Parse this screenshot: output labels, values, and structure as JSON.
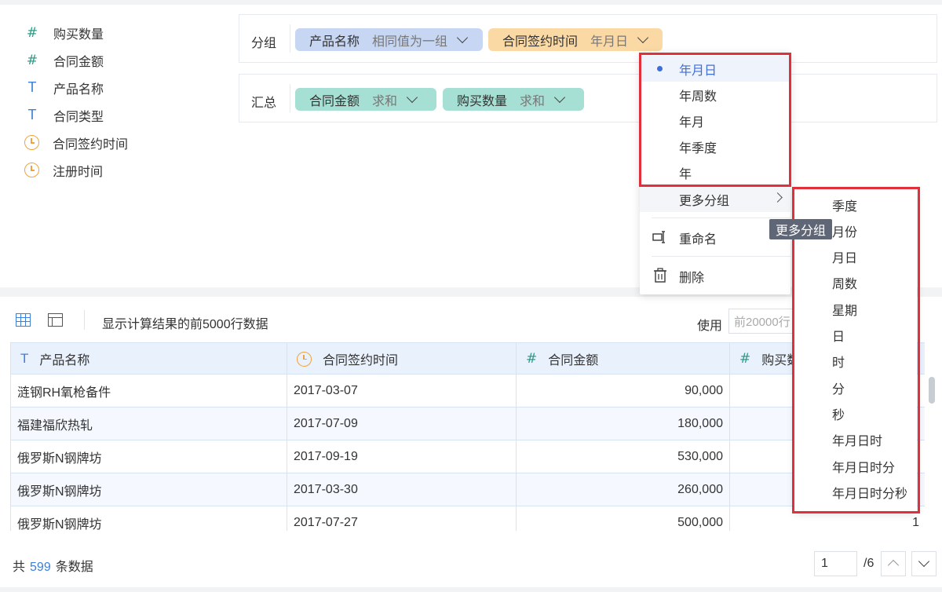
{
  "fields": [
    {
      "type_glyph": "#",
      "label": "购买数量"
    },
    {
      "type_glyph": "#",
      "label": "合同金额"
    },
    {
      "type_glyph": "T",
      "label": "产品名称"
    },
    {
      "type_glyph": "T",
      "label": "合同类型"
    },
    {
      "type_glyph": "clock-icon",
      "label": "合同签约时间"
    },
    {
      "type_glyph": "clock-icon",
      "label": "注册时间"
    }
  ],
  "group": {
    "label": "分组",
    "tags": [
      {
        "name": "产品名称",
        "sub": "相同值为一组",
        "color": "#c7d6f2"
      },
      {
        "name": "合同签约时间",
        "sub": "年月日",
        "color": "#fbd9a4"
      }
    ]
  },
  "summary": {
    "label": "汇总",
    "tags": [
      {
        "name": "合同金额",
        "sub": "求和",
        "color": "#a6dfd3"
      },
      {
        "name": "购买数量",
        "sub": "求和",
        "color": "#a6dfd3"
      }
    ]
  },
  "menu": {
    "items": [
      "年月日",
      "年周数",
      "年月",
      "年季度",
      "年"
    ],
    "selected": "年月日",
    "more": "更多分组",
    "rename": "重命名",
    "delete": "删除"
  },
  "tooltip": "更多分组",
  "submenu": [
    "季度",
    "月份",
    "月日",
    "周数",
    "星期",
    "日",
    "时",
    "分",
    "秒",
    "年月日时",
    "年月日时分",
    "年月日时分秒"
  ],
  "toolbar": {
    "info": "显示计算结果的前5000行数据",
    "use_label": "使用",
    "use_value": "前20000行"
  },
  "table": {
    "columns": [
      {
        "glyph": "T",
        "label": "产品名称"
      },
      {
        "glyph": "clock-icon",
        "label": "合同签约时间"
      },
      {
        "glyph": "#",
        "label": "合同金额"
      },
      {
        "glyph": "#",
        "label": "购买数量"
      }
    ],
    "rows": [
      {
        "product": "涟钢RH氧枪备件",
        "date": "2017-03-07",
        "amount": "90,000",
        "qty": ""
      },
      {
        "product": "福建福欣热轧",
        "date": "2017-07-09",
        "amount": "180,000",
        "qty": ""
      },
      {
        "product": "俄罗斯N钢牌坊",
        "date": "2017-09-19",
        "amount": "530,000",
        "qty": ""
      },
      {
        "product": "俄罗斯N钢牌坊",
        "date": "2017-03-30",
        "amount": "260,000",
        "qty": ""
      },
      {
        "product": "俄罗斯N钢牌坊",
        "date": "2017-07-27",
        "amount": "500,000",
        "qty": "1"
      }
    ]
  },
  "footer": {
    "prefix": "共",
    "count": "599",
    "suffix": "条数据",
    "page": "1",
    "total": "/6"
  },
  "colors": {
    "accent": "#3d7fd9",
    "highlight_box": "#e0303b",
    "number_field": "#2d9c87",
    "date_field": "#f0a33c"
  }
}
